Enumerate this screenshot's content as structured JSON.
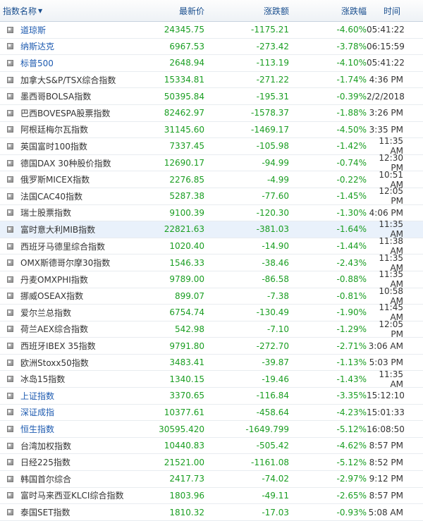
{
  "header": {
    "name": "指数名称",
    "price": "最新价",
    "change": "涨跌额",
    "pct": "涨跌幅",
    "time": "时间"
  },
  "rows": [
    {
      "name": "道琼斯",
      "price": "24345.75",
      "change": "-1175.21",
      "pct": "-4.60%",
      "time": "05:41:22",
      "link": true
    },
    {
      "name": "纳斯达克",
      "price": "6967.53",
      "change": "-273.42",
      "pct": "-3.78%",
      "time": "06:15:59",
      "link": true
    },
    {
      "name": "标普500",
      "price": "2648.94",
      "change": "-113.19",
      "pct": "-4.10%",
      "time": "05:41:22",
      "link": true
    },
    {
      "name": "加拿大S&P/TSX综合指数",
      "price": "15334.81",
      "change": "-271.22",
      "pct": "-1.74%",
      "time": "4:36 PM",
      "link": false
    },
    {
      "name": "墨西哥BOLSA指数",
      "price": "50395.84",
      "change": "-195.31",
      "pct": "-0.39%",
      "time": "2/2/2018",
      "link": false
    },
    {
      "name": "巴西BOVESPA股票指数",
      "price": "82462.97",
      "change": "-1578.37",
      "pct": "-1.88%",
      "time": "3:26 PM",
      "link": false
    },
    {
      "name": "阿根廷梅尔瓦指数",
      "price": "31145.60",
      "change": "-1469.17",
      "pct": "-4.50%",
      "time": "3:35 PM",
      "link": false
    },
    {
      "name": "英国富时100指数",
      "price": "7337.45",
      "change": "-105.98",
      "pct": "-1.42%",
      "time": "11:35 AM",
      "link": false
    },
    {
      "name": "德国DAX 30种股价指数",
      "price": "12690.17",
      "change": "-94.99",
      "pct": "-0.74%",
      "time": "12:30 PM",
      "link": false
    },
    {
      "name": "俄罗斯MICEX指数",
      "price": "2276.85",
      "change": "-4.99",
      "pct": "-0.22%",
      "time": "10:51 AM",
      "link": false
    },
    {
      "name": "法国CAC40指数",
      "price": "5287.38",
      "change": "-77.60",
      "pct": "-1.45%",
      "time": "12:05 PM",
      "link": false
    },
    {
      "name": "瑞士股票指数",
      "price": "9100.39",
      "change": "-120.30",
      "pct": "-1.30%",
      "time": "4:06 PM",
      "link": false
    },
    {
      "name": "富时意大利MIB指数",
      "price": "22821.63",
      "change": "-381.03",
      "pct": "-1.64%",
      "time": "11:35 AM",
      "link": false,
      "highlight": true
    },
    {
      "name": "西班牙马德里综合指数",
      "price": "1020.40",
      "change": "-14.90",
      "pct": "-1.44%",
      "time": "11:38 AM",
      "link": false
    },
    {
      "name": "OMX斯德哥尔摩30指数",
      "price": "1546.33",
      "change": "-38.46",
      "pct": "-2.43%",
      "time": "11:35 AM",
      "link": false
    },
    {
      "name": "丹麦OMXPHI指数",
      "price": "9789.00",
      "change": "-86.58",
      "pct": "-0.88%",
      "time": "11:35 AM",
      "link": false
    },
    {
      "name": "挪威OSEAX指数",
      "price": "899.07",
      "change": "-7.38",
      "pct": "-0.81%",
      "time": "10:58 AM",
      "link": false
    },
    {
      "name": "爱尔兰总指数",
      "price": "6754.74",
      "change": "-130.49",
      "pct": "-1.90%",
      "time": "11:45 AM",
      "link": false
    },
    {
      "name": "荷兰AEX综合指数",
      "price": "542.98",
      "change": "-7.10",
      "pct": "-1.29%",
      "time": "12:05 PM",
      "link": false
    },
    {
      "name": "西班牙IBEX 35指数",
      "price": "9791.80",
      "change": "-272.70",
      "pct": "-2.71%",
      "time": "3:06 AM",
      "link": false
    },
    {
      "name": "欧洲Stoxx50指数",
      "price": "3483.41",
      "change": "-39.87",
      "pct": "-1.13%",
      "time": "5:03 PM",
      "link": false
    },
    {
      "name": "冰岛15指数",
      "price": "1340.15",
      "change": "-19.46",
      "pct": "-1.43%",
      "time": "11:35 AM",
      "link": false
    },
    {
      "name": "上证指数",
      "price": "3370.65",
      "change": "-116.84",
      "pct": "-3.35%",
      "time": "15:12:10",
      "link": true
    },
    {
      "name": "深证成指",
      "price": "10377.61",
      "change": "-458.64",
      "pct": "-4.23%",
      "time": "15:01:33",
      "link": true
    },
    {
      "name": "恒生指数",
      "price": "30595.420",
      "change": "-1649.799",
      "pct": "-5.12%",
      "time": "16:08:50",
      "link": true
    },
    {
      "name": "台湾加权指数",
      "price": "10440.83",
      "change": "-505.42",
      "pct": "-4.62%",
      "time": "8:57 PM",
      "link": false
    },
    {
      "name": "日经225指数",
      "price": "21521.00",
      "change": "-1161.08",
      "pct": "-5.12%",
      "time": "8:52 PM",
      "link": false
    },
    {
      "name": "韩国首尔综合",
      "price": "2417.73",
      "change": "-74.02",
      "pct": "-2.97%",
      "time": "9:12 PM",
      "link": false
    },
    {
      "name": "富时马来西亚KLCI综合指数",
      "price": "1803.96",
      "change": "-49.11",
      "pct": "-2.65%",
      "time": "8:57 PM",
      "link": false
    },
    {
      "name": "泰国SET指数",
      "price": "1810.32",
      "change": "-17.03",
      "pct": "-0.93%",
      "time": "5:08 AM",
      "link": false
    }
  ],
  "colors": {
    "link": "#1e5bb0",
    "negative": "#1a9e22",
    "header_text": "#1a4f8f",
    "highlight": "#e9f1fb"
  }
}
